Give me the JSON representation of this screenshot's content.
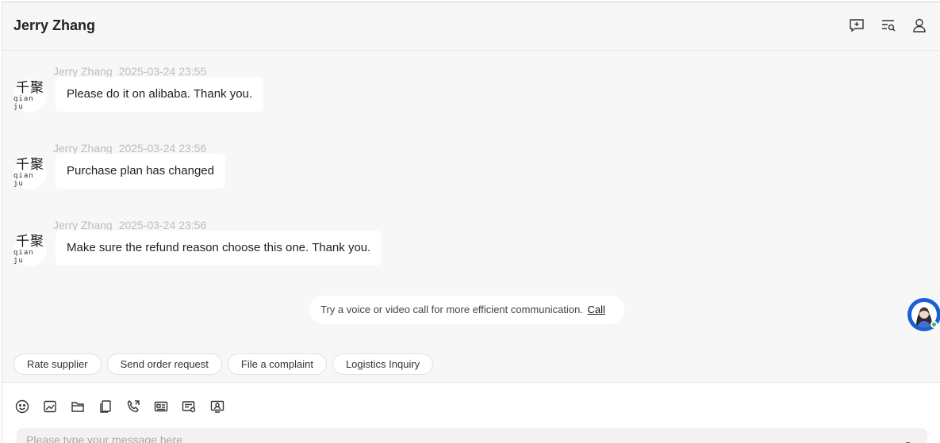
{
  "header": {
    "title": "Jerry Zhang",
    "icons": [
      "add-comment-icon",
      "search-messages-icon",
      "user-profile-icon"
    ]
  },
  "avatar": {
    "logo": "千聚",
    "subtext": "qian ju"
  },
  "messages": [
    {
      "sender": "Jerry Zhang",
      "time": "2025-03-24 23:55",
      "text": "Please do it on alibaba. Thank you."
    },
    {
      "sender": "Jerry Zhang",
      "time": "2025-03-24 23:56",
      "text": "Purchase plan has changed"
    },
    {
      "sender": "Jerry Zhang",
      "time": "2025-03-24 23:56",
      "text": "Make sure the refund reason choose this one. Thank you."
    }
  ],
  "notice": {
    "text": "Try a voice or video call for more efficient communication.",
    "call_label": "Call"
  },
  "quick_actions": [
    "Rate supplier",
    "Send order request",
    "File a complaint",
    "Logistics Inquiry"
  ],
  "toolbar": {
    "icons": [
      "emoji-icon",
      "image-icon",
      "folder-icon",
      "copy-icon",
      "phone-call-icon",
      "contact-card-icon",
      "invoice-icon",
      "screen-share-icon"
    ]
  },
  "input": {
    "placeholder": "Please type your message here",
    "value": ""
  },
  "colors": {
    "accent": "#1a5fd6",
    "online": "#22c55e",
    "meta_text": "#bdbdbd"
  }
}
